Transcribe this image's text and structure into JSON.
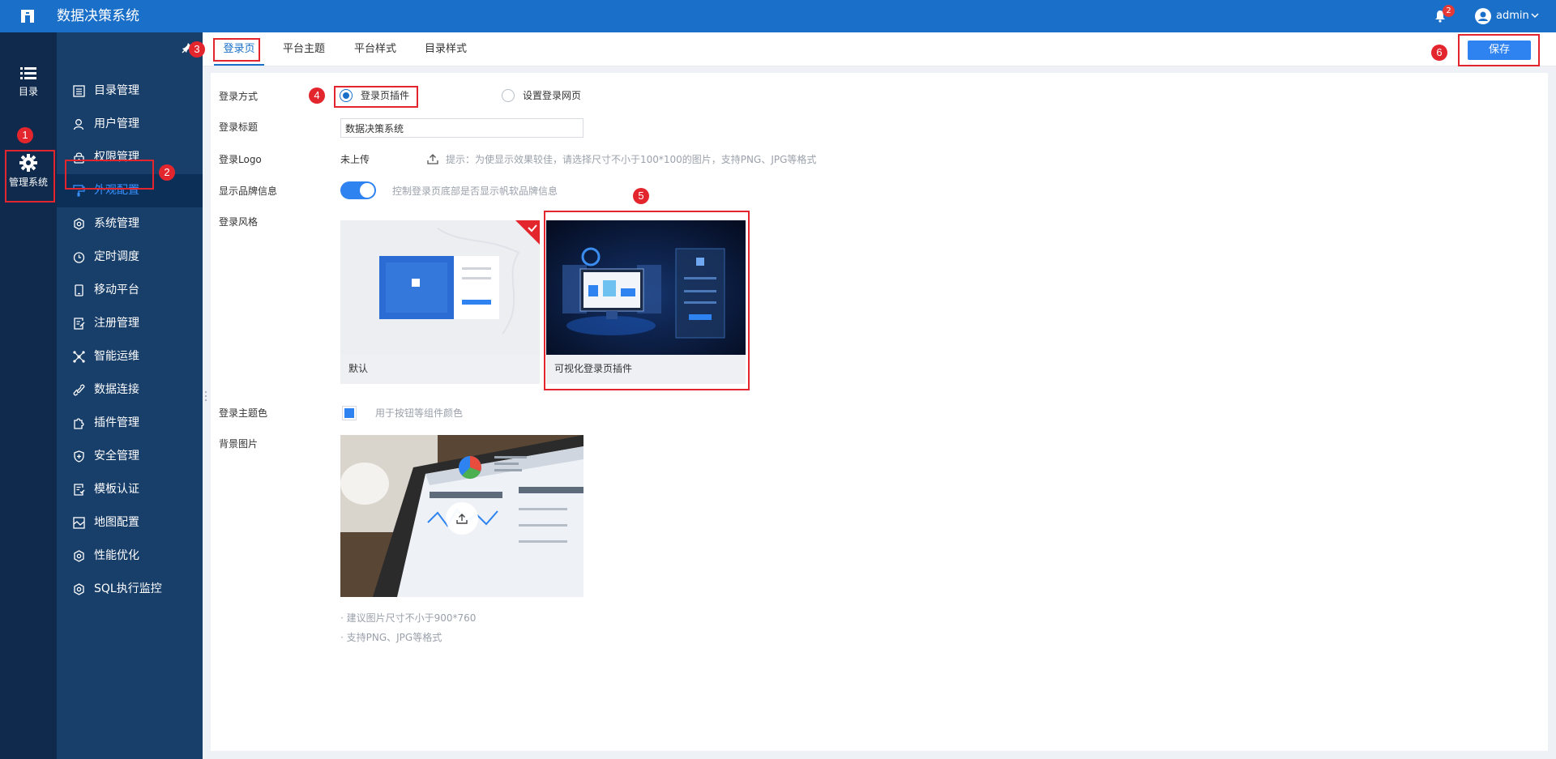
{
  "header": {
    "app_title": "数据决策系统",
    "notification_count": "2",
    "user_name": "admin",
    "brand_color": "#1a6fc9"
  },
  "rail": {
    "items": [
      {
        "label": "目录",
        "icon": "list-icon"
      },
      {
        "label": "管理系统",
        "icon": "gear-icon"
      }
    ]
  },
  "sidebar": {
    "items": [
      {
        "label": "目录管理",
        "icon": "catalog-icon"
      },
      {
        "label": "用户管理",
        "icon": "user-icon"
      },
      {
        "label": "权限管理",
        "icon": "lock-icon"
      },
      {
        "label": "外观配置",
        "icon": "paint-roller-icon",
        "active": true
      },
      {
        "label": "系统管理",
        "icon": "settings-icon"
      },
      {
        "label": "定时调度",
        "icon": "clock-icon"
      },
      {
        "label": "移动平台",
        "icon": "mobile-icon"
      },
      {
        "label": "注册管理",
        "icon": "register-icon"
      },
      {
        "label": "智能运维",
        "icon": "network-icon"
      },
      {
        "label": "数据连接",
        "icon": "link-icon"
      },
      {
        "label": "插件管理",
        "icon": "puzzle-icon"
      },
      {
        "label": "安全管理",
        "icon": "shield-icon"
      },
      {
        "label": "模板认证",
        "icon": "template-icon"
      },
      {
        "label": "地图配置",
        "icon": "map-icon"
      },
      {
        "label": "性能优化",
        "icon": "performance-icon"
      },
      {
        "label": "SQL执行监控",
        "icon": "monitor-icon"
      }
    ]
  },
  "tabs": [
    {
      "label": "登录页",
      "active": true
    },
    {
      "label": "平台主题"
    },
    {
      "label": "平台样式"
    },
    {
      "label": "目录样式"
    }
  ],
  "toolbar": {
    "save_label": "保存"
  },
  "form": {
    "login_method": {
      "label": "登录方式",
      "options": [
        {
          "label": "登录页插件",
          "checked": true
        },
        {
          "label": "设置登录网页",
          "checked": false
        }
      ]
    },
    "login_title": {
      "label": "登录标题",
      "value": "数据决策系统"
    },
    "login_logo": {
      "label": "登录Logo",
      "status": "未上传",
      "hint": "提示：为使显示效果较佳，请选择尺寸不小于100*100的图片，支持PNG、JPG等格式"
    },
    "brand_info": {
      "label": "显示品牌信息",
      "enabled": true,
      "hint": "控制登录页底部是否显示帆软品牌信息"
    },
    "login_style": {
      "label": "登录风格",
      "options": [
        {
          "label": "默认",
          "selected": true
        },
        {
          "label": "可视化登录页插件",
          "selected": false
        }
      ]
    },
    "theme_color": {
      "label": "登录主题色",
      "value": "#2f83f0",
      "hint": "用于按钮等组件颜色"
    },
    "bg_image": {
      "label": "背景图片",
      "notes": [
        "· 建议图片尺寸不小于900*760",
        "· 支持PNG、JPG等格式"
      ]
    }
  },
  "annotations": [
    "1",
    "2",
    "3",
    "4",
    "5",
    "6"
  ]
}
